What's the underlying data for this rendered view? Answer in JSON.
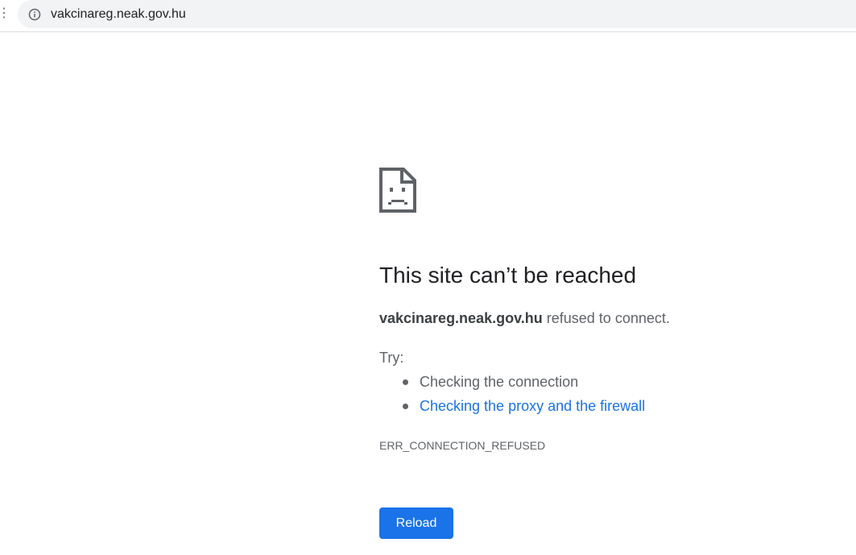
{
  "browser": {
    "address_bar": {
      "url": "vakcinareg.neak.gov.hu",
      "security_icon": "info-circle-icon"
    }
  },
  "error_page": {
    "icon": "sad-page-icon",
    "title": "This site can’t be reached",
    "host": "vakcinareg.neak.gov.hu",
    "message": "refused to connect.",
    "try_label": "Try:",
    "suggestions": [
      {
        "text": "Checking the connection",
        "is_link": false
      },
      {
        "text": "Checking the proxy and the firewall",
        "is_link": true
      }
    ],
    "error_code": "ERR_CONNECTION_REFUSED",
    "reload_label": "Reload"
  },
  "colors": {
    "accent": "#1a73e8",
    "text_primary": "#202124",
    "text_secondary": "#5f6368",
    "omnibox_bg": "#f1f3f4"
  }
}
